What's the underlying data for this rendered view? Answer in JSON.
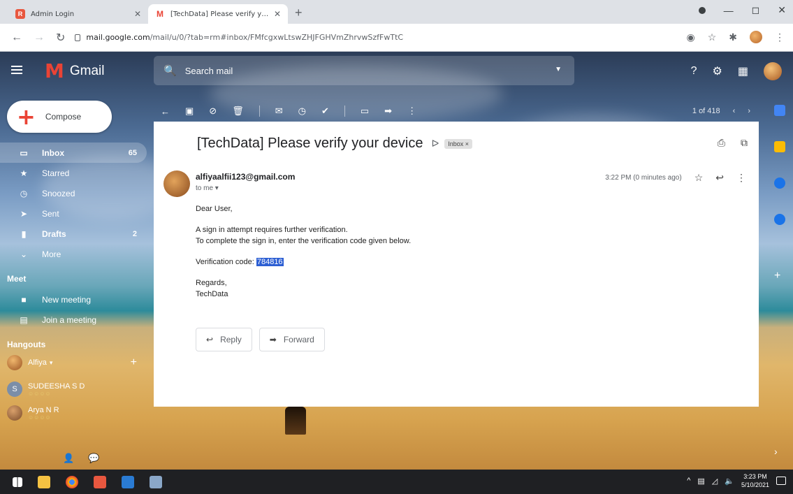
{
  "browser": {
    "tabs": [
      {
        "label": "Admin Login",
        "favicon_color": "#e8573f",
        "favicon_text": "R"
      },
      {
        "label": "[TechData] Please verify your dev",
        "favicon_color": "#ea4335",
        "favicon_text": "M"
      }
    ],
    "new_tab": "+",
    "url_host": "mail.google.com",
    "url_path": "/mail/u/0/?tab=rm#inbox/FMfcgxwLtswZHJFGHVmZhrvwSzfFwTtC"
  },
  "gmail": {
    "logo_text": "Gmail",
    "search_placeholder": "Search mail",
    "compose_label": "Compose",
    "nav": [
      {
        "label": "Inbox",
        "count": "65",
        "icon": "inbox-icon"
      },
      {
        "label": "Starred",
        "count": "",
        "icon": "star-icon"
      },
      {
        "label": "Snoozed",
        "count": "",
        "icon": "clock-icon"
      },
      {
        "label": "Sent",
        "count": "",
        "icon": "send-icon"
      },
      {
        "label": "Drafts",
        "count": "2",
        "icon": "draft-icon"
      },
      {
        "label": "More",
        "count": "",
        "icon": "chevron-down-icon"
      }
    ],
    "meet": {
      "heading": "Meet",
      "new_meeting": "New meeting",
      "join_meeting": "Join a meeting"
    },
    "hangouts": {
      "heading": "Hangouts",
      "users": [
        {
          "name": "Alfiya",
          "sub": ""
        },
        {
          "name": "SUDEESHA S D",
          "sub": "☺☺☺☺"
        },
        {
          "name": "Arya N R",
          "sub": "☺☺☺☺"
        }
      ],
      "self_initial": "S"
    },
    "pager": "1 of 418"
  },
  "email": {
    "subject": "[TechData] Please verify your device",
    "label": "Inbox ×",
    "sender": "alfiyaalfii123@gmail.com",
    "to": "to me ▾",
    "time": "3:22 PM (0 minutes ago)",
    "greeting": "Dear User,",
    "line1": "A sign in attempt requires further verification.",
    "line2": "To complete the sign in, enter the verification code given below.",
    "code_label": "Verification code: ",
    "code": "784816",
    "regards": "Regards,",
    "signature": "TechData",
    "reply_label": "Reply",
    "forward_label": "Forward"
  },
  "taskbar": {
    "time": "3:23 PM",
    "date": "5/10/2021"
  }
}
